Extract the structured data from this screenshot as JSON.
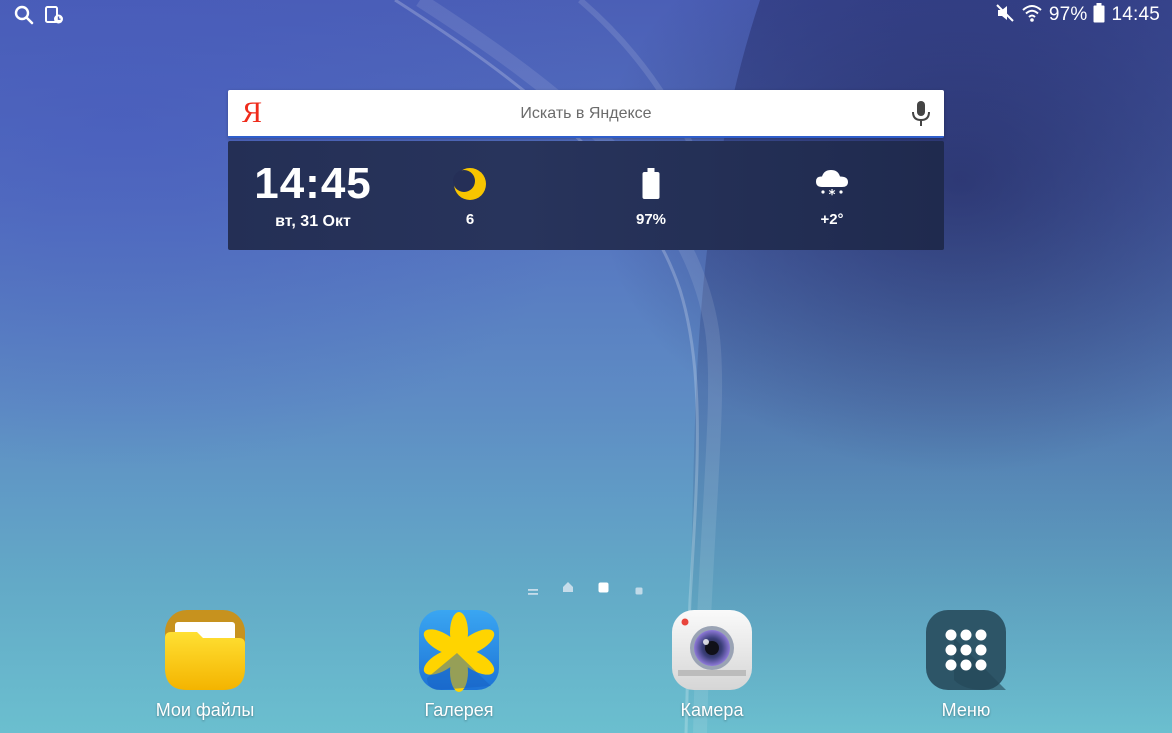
{
  "status_bar": {
    "battery_text": "97%",
    "time": "14:45",
    "left_icons": [
      "search-icon",
      "device-sync-icon"
    ],
    "right_icons": [
      "mute-icon",
      "wifi-icon",
      "battery-icon"
    ]
  },
  "search": {
    "logo": "Я",
    "placeholder": "Искать в Яндексе",
    "mic_icon": "microphone-icon",
    "logo_color": "#ef2b1b"
  },
  "widget": {
    "time": "14:45",
    "date": "вт, 31 Окт",
    "moon_value": "6",
    "battery_value": "97%",
    "weather_value": "+2°",
    "icons": [
      "moon-icon",
      "battery-icon",
      "snow-cloud-icon"
    ],
    "moon_color": "#f7c500"
  },
  "pager": {
    "pages": [
      "menu-page",
      "home-page",
      "page-2",
      "page-3"
    ],
    "active": 2
  },
  "dock": {
    "apps": [
      {
        "label": "Мои файлы",
        "icon": "folder-icon",
        "color": "#f9c400"
      },
      {
        "label": "Галерея",
        "icon": "gallery-flower-icon",
        "color": "#2d8ee9"
      },
      {
        "label": "Камера",
        "icon": "camera-icon",
        "color": "#eeeeee"
      },
      {
        "label": "Меню",
        "icon": "apps-grid-icon",
        "color": "#2d5567"
      }
    ]
  }
}
